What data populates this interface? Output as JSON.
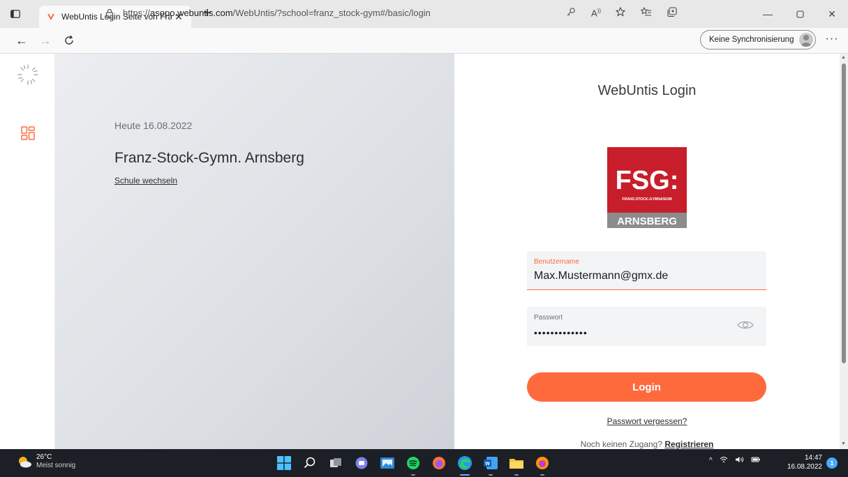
{
  "browser": {
    "tab_title": "WebUntis Login Seite von Franz-",
    "url_prefix": "https://",
    "url_host": "asopo.webuntis.com",
    "url_path": "/WebUntis/?school=franz_stock-gym#/basic/login",
    "sync_label": "Keine Synchronisierung",
    "more_label": "···"
  },
  "school_panel": {
    "date_label": "Heute 16.08.2022",
    "school_name": "Franz-Stock-Gymn. Arnsberg",
    "switch_link": "Schule wechseln"
  },
  "login": {
    "title": "WebUntis Login",
    "logo": {
      "main": "FSG:",
      "sub": "FRANZ-STOCK-GYMNASIUM",
      "bottom": "ARNSBERG",
      "color_red": "#c81e2b",
      "color_gray": "#8c8c8c"
    },
    "username_label": "Benutzername",
    "username_value": "Max.Mustermann@gmx.de",
    "password_label": "Passwort",
    "password_value": "•••••••••••••",
    "login_button": "Login",
    "forgot_link": "Passwort vergessen?",
    "no_access_text": "Noch keinen Zugang?",
    "register_link": "Registrieren",
    "accent_color": "#ff6a3d"
  },
  "taskbar": {
    "temperature": "26°C",
    "weather_desc": "Meist sonnig",
    "tray_chevron": "^",
    "time": "14:47",
    "date": "16.08.2022",
    "notification_count": "1"
  }
}
